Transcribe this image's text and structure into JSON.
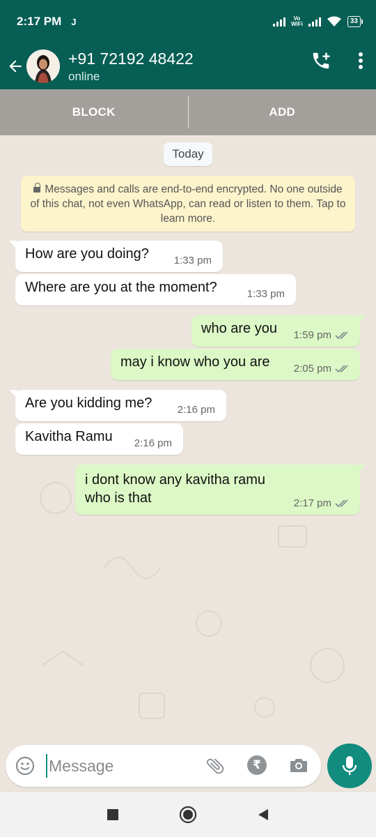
{
  "status_bar": {
    "time": "2:17 PM",
    "carrier_icon": "J",
    "vowifi_label_top": "Vo",
    "vowifi_label_bottom": "WiFi",
    "battery": "33"
  },
  "header": {
    "contact_name": "+91 72192 48422",
    "subtitle": "online",
    "icons": [
      "back-arrow-icon",
      "add-call-icon",
      "more-vert-icon"
    ]
  },
  "action_bar": {
    "block_label": "BLOCK",
    "add_label": "ADD"
  },
  "chat": {
    "date_chip": "Today",
    "encryption_notice": "Messages and calls are end-to-end encrypted. No one outside of this chat, not even WhatsApp, can read or listen to them. Tap to learn more.",
    "messages": [
      {
        "direction": "in",
        "text": "How are you doing?",
        "time": "1:33 pm"
      },
      {
        "direction": "in",
        "text": "Where are you at the moment?",
        "time": "1:33 pm"
      },
      {
        "direction": "out",
        "text": "who are you",
        "time": "1:59 pm",
        "status": "delivered"
      },
      {
        "direction": "out",
        "text": "may i know who you are",
        "time": "2:05 pm",
        "status": "delivered"
      },
      {
        "direction": "in",
        "text": "Are you kidding me?",
        "time": "2:16 pm"
      },
      {
        "direction": "in",
        "text": "Kavitha Ramu",
        "time": "2:16 pm"
      },
      {
        "direction": "out",
        "text_line1": "i dont know any kavitha ramu",
        "text_line2": "who is that",
        "time": "2:17 pm",
        "status": "delivered"
      }
    ]
  },
  "composer": {
    "placeholder": "Message",
    "value": "",
    "icons": [
      "emoji-icon",
      "attach-icon",
      "rupee-payment-icon",
      "camera-icon",
      "mic-icon"
    ]
  },
  "colors": {
    "header": "#075e54",
    "accent": "#128c7e",
    "outgoing_bubble": "#dcf8c6",
    "chat_bg": "#ece5dd"
  }
}
